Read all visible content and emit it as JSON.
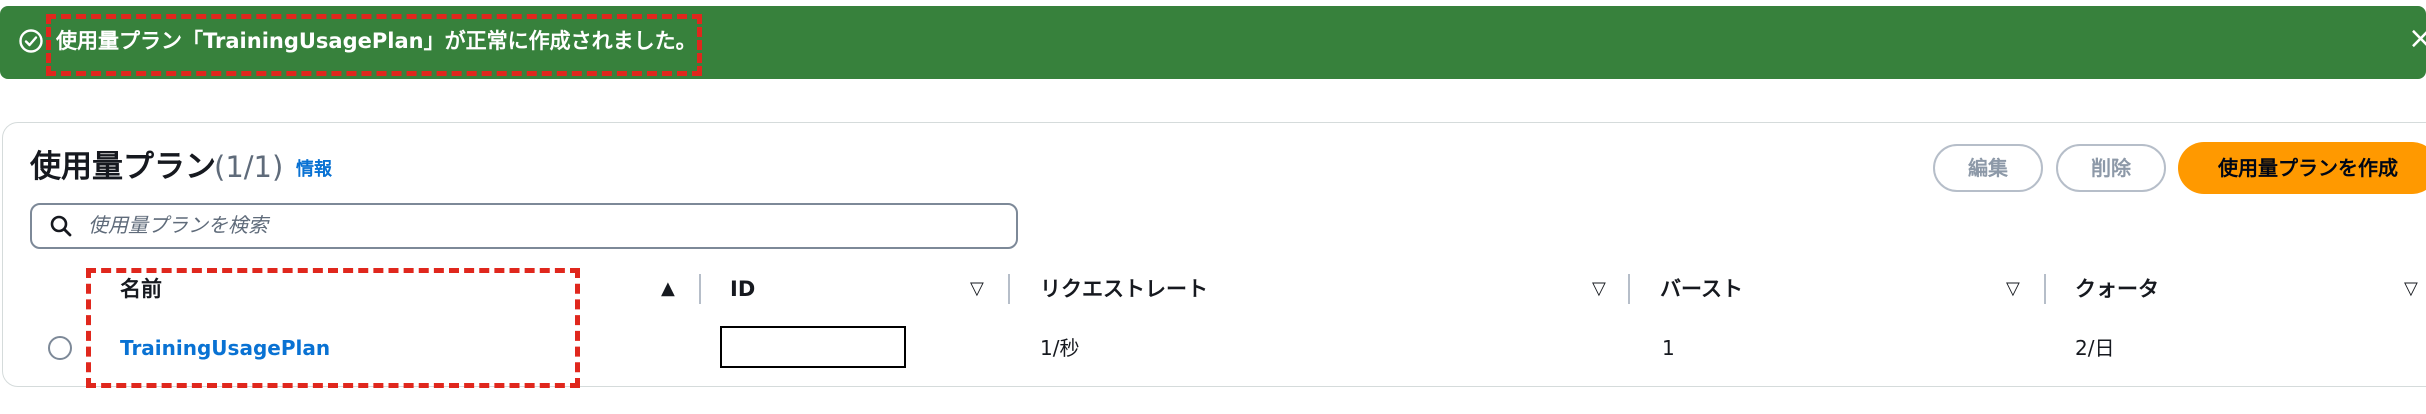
{
  "flash": {
    "message": "使用量プラン「TrainingUsagePlan」が正常に作成されました。",
    "close": "×",
    "color": "#37813c"
  },
  "header": {
    "title": "使用量プラン",
    "count": "(1/1)",
    "info": "情報"
  },
  "actions": {
    "edit": "編集",
    "delete": "削除",
    "create": "使用量プランを作成",
    "create_color": "#ff9900"
  },
  "search": {
    "placeholder": "使用量プランを検索",
    "value": ""
  },
  "table": {
    "columns": [
      {
        "label": "名前",
        "sort": "▲"
      },
      {
        "label": "ID",
        "sort": "▽"
      },
      {
        "label": "リクエストレート",
        "sort": "▽"
      },
      {
        "label": "バースト",
        "sort": "▽"
      },
      {
        "label": "クォータ",
        "sort": "▽"
      }
    ],
    "rows": [
      {
        "name": "TrainingUsagePlan",
        "id": "",
        "rate": "1/秒",
        "burst": "1",
        "quota": "2/日"
      }
    ]
  },
  "annotation_color": "#e0271d"
}
